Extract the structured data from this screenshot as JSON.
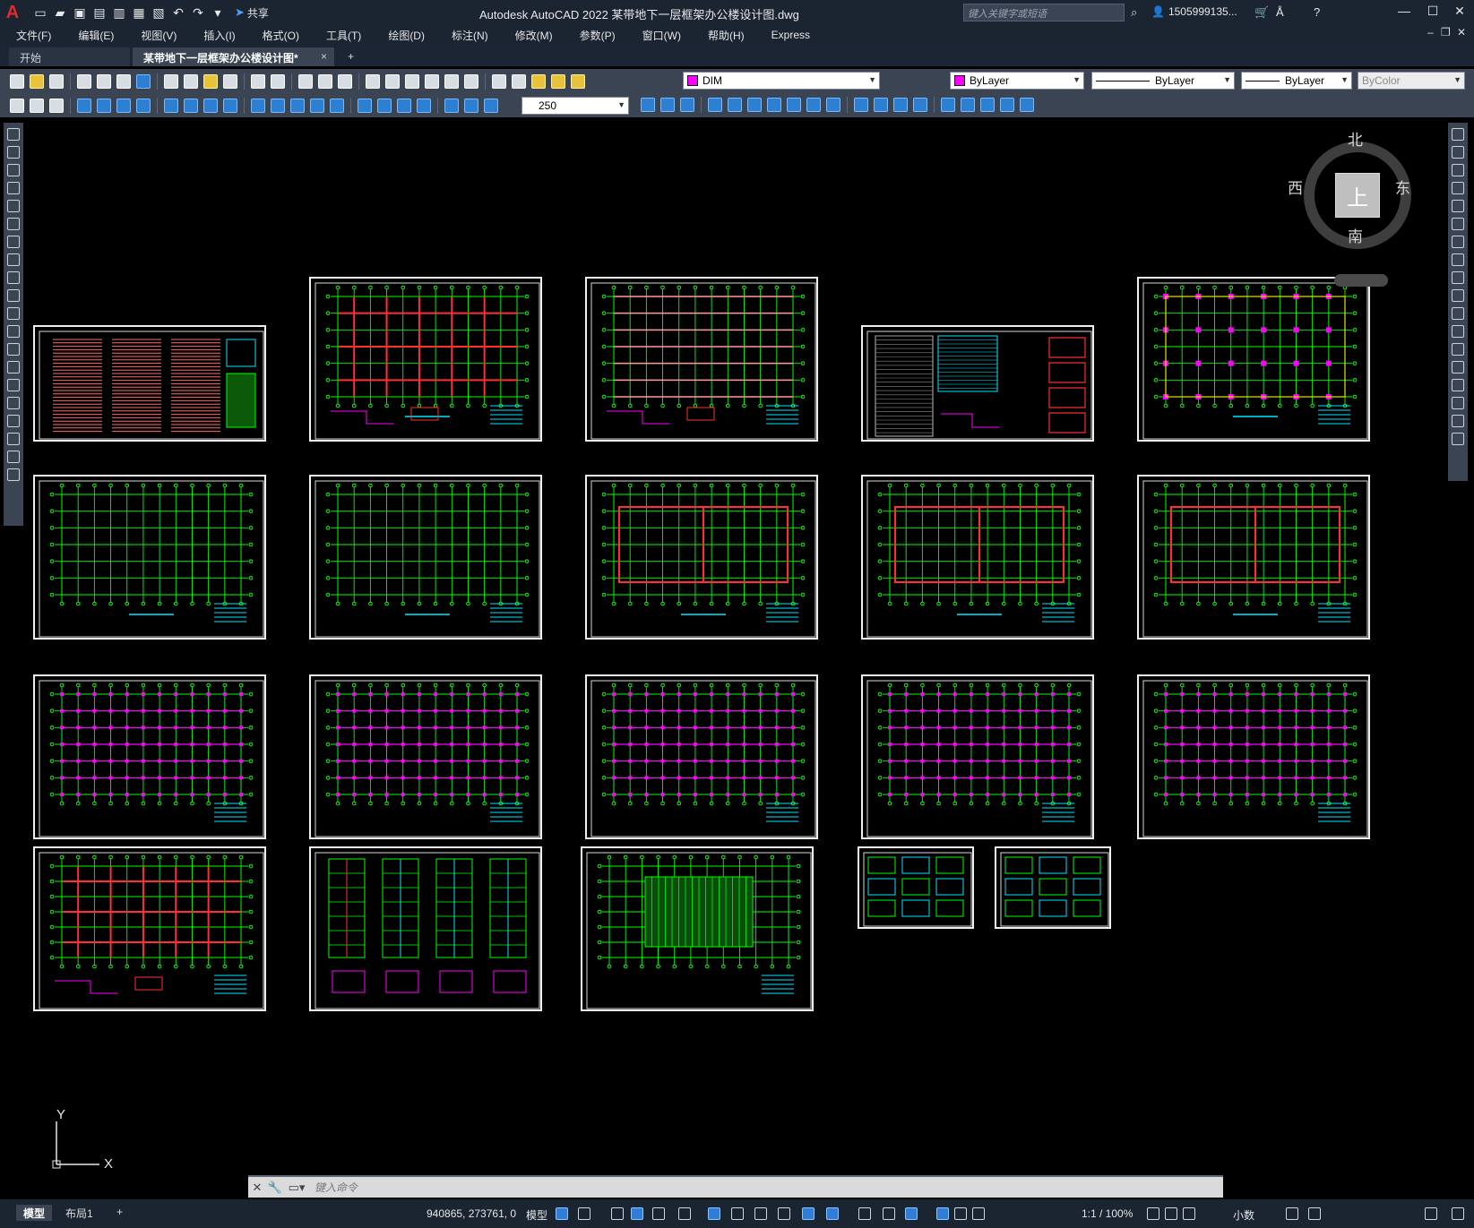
{
  "app": {
    "logo": "A",
    "title": "Autodesk AutoCAD 2022    某带地下一层框架办公楼设计图.dwg",
    "share_label": "共享",
    "search_placeholder": "键入关键字或短语",
    "user": "1505999135...",
    "window_controls": [
      "—",
      "☐",
      "✕"
    ]
  },
  "menu": {
    "items": [
      "文件(F)",
      "编辑(E)",
      "视图(V)",
      "插入(I)",
      "格式(O)",
      "工具(T)",
      "绘图(D)",
      "标注(N)",
      "修改(M)",
      "参数(P)",
      "窗口(W)",
      "帮助(H)",
      "Express"
    ]
  },
  "tabs": {
    "start": "开始",
    "active": "某带地下一层框架办公楼设计图*",
    "close": "×",
    "add": "+"
  },
  "toolbar": {
    "layer": "DIM",
    "color": "ByLayer",
    "linetype": "ByLayer",
    "lineweight": "ByLayer",
    "plotstyle": "ByColor",
    "dimscale": "250"
  },
  "viewcube": {
    "face": "上",
    "north": "北",
    "south": "南",
    "east": "东",
    "west": "西"
  },
  "ucs": {
    "x": "X",
    "y": "Y"
  },
  "command": {
    "placeholder": "键入命令"
  },
  "status": {
    "model_tab": "模型",
    "layout_tab": "布局1",
    "add_tab": "+",
    "coords": "940865, 273761, 0",
    "model_label": "模型",
    "scale": "1:1 / 100%",
    "units": "小数"
  },
  "colors": {
    "accent": "#2f7dd4",
    "layer_color": "#ff00ff",
    "drawing_green": "#00ff00",
    "drawing_red": "#ff3030",
    "drawing_cyan": "#00e5ff",
    "drawing_magenta": "#ff00ff"
  }
}
